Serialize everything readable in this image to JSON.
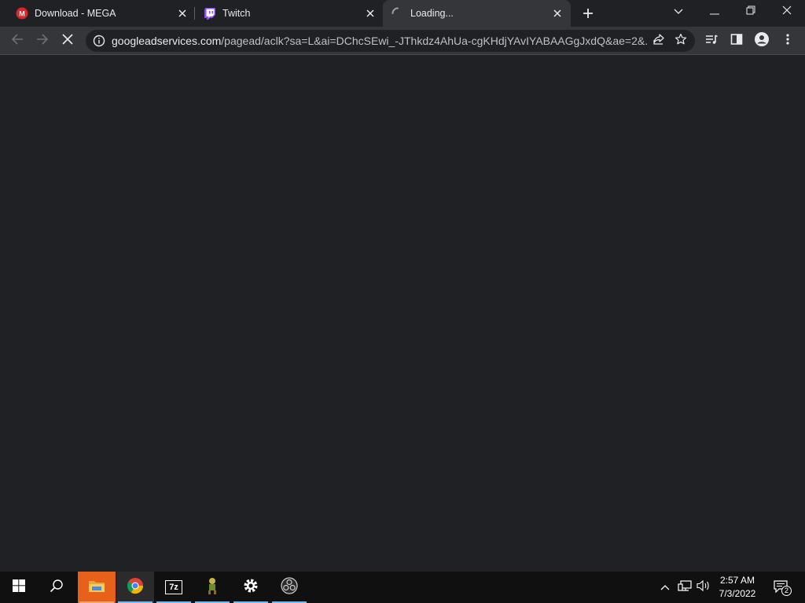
{
  "browser": {
    "tabs": [
      {
        "title": "Download - MEGA",
        "icon": "mega-icon",
        "active": false
      },
      {
        "title": "Twitch",
        "icon": "twitch-icon",
        "active": false
      },
      {
        "title": "Loading...",
        "icon": "loading-spinner-icon",
        "active": true
      }
    ],
    "address": {
      "host": "googleadservices.com",
      "path": "/pagead/aclk?sa=L&ai=DChcSEwi_-JThkdz4AhUa-cgKHdjYAvIYABAAGgJxdQ&ae=2&..."
    },
    "colors": {
      "background": "#202124",
      "toolbar": "#35363a",
      "text": "#e8eaed"
    }
  },
  "taskbar": {
    "pinned": [
      "windows-start-icon",
      "search-icon",
      "file-explorer-icon",
      "chrome-icon",
      "7zip-icon",
      "app-figure-icon",
      "settings-icon",
      "obs-icon"
    ],
    "tray": {
      "time": "2:57 AM",
      "date": "7/3/2022",
      "notification_count": "2"
    },
    "labels": {
      "sevenzip": "7z"
    }
  }
}
